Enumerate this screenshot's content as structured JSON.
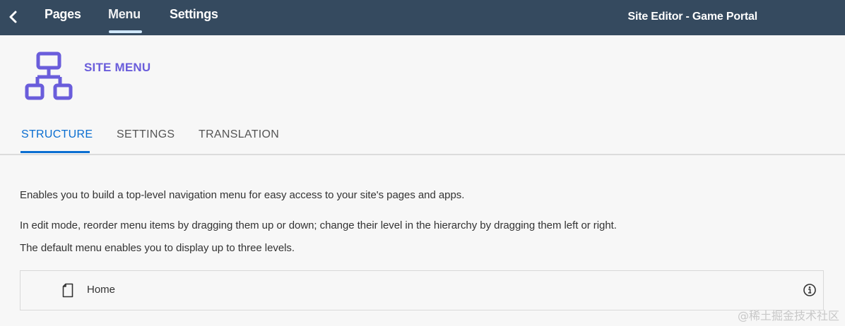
{
  "topbar": {
    "tabs": [
      {
        "label": "Pages"
      },
      {
        "label": "Menu",
        "active": true
      },
      {
        "label": "Settings"
      }
    ],
    "site_title": "Site Editor - Game Portal"
  },
  "header": {
    "icon": "sitemap-icon",
    "title": "SITE MENU",
    "accent_color": "#6a5ddb"
  },
  "subtabs": [
    {
      "label": "STRUCTURE",
      "active": true
    },
    {
      "label": "SETTINGS"
    },
    {
      "label": "TRANSLATION"
    }
  ],
  "content": {
    "paragraphs": [
      "Enables you to build a top-level navigation menu for easy access to your site's pages and apps.",
      "In edit mode, reorder menu items by dragging them up or down; change their level in the hierarchy by dragging them left or right.",
      "The default menu enables you to display up to three levels."
    ],
    "menu_items": [
      {
        "label": "Home",
        "icon": "page-icon",
        "action_icon": "info-icon"
      }
    ]
  },
  "watermark": "@稀土掘金技术社区",
  "colors": {
    "topbar_bg": "#354a5f",
    "active_tab": "#0a6ed1"
  }
}
